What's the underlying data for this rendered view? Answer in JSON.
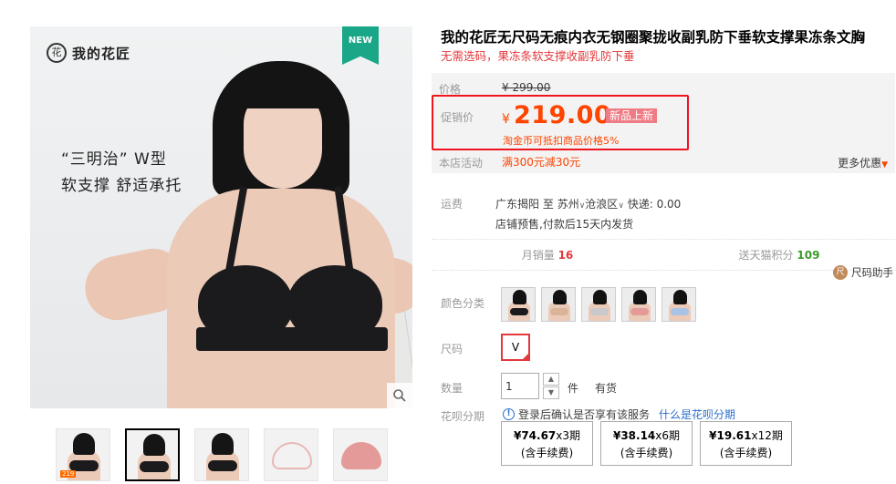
{
  "gallery": {
    "brand_logo_text": "我的花匠",
    "brand_logo_mark": "花",
    "new_badge": "NEW",
    "promo_line1": "“三明治” W型",
    "promo_line2": "软支撑  舒适承托",
    "thumbnail_price_tag": "219",
    "zoom_icon": "magnifier-icon",
    "thumbnail_count": 5,
    "active_thumbnail_index": 1
  },
  "product": {
    "title": "我的花匠无尺码无痕内衣无钢圈聚拢收副乳防下垂软支撑果冻条文胸",
    "subtitle": "无需选码，果冻条软支撑收副乳防下垂"
  },
  "pricing": {
    "original_label": "价格",
    "original_price": "¥ 299.00",
    "promo_label": "促销价",
    "currency_symbol": "¥",
    "promo_price": "219.00",
    "promo_tag": "新品上新",
    "coin_note": "淘金币可抵扣商品价格5%",
    "activity_label": "本店活动",
    "activity_value": "满300元减30元",
    "more_offers": "更多优惠",
    "more_offers_icon": "caret-down-icon"
  },
  "shipping": {
    "label": "运费",
    "origin": "广东揭阳",
    "to": "至",
    "city": "苏州",
    "district": "沧浪区",
    "express": "快递: 0.00",
    "presale_note": "店铺预售,付款后15天内发货"
  },
  "stats": {
    "monthly_sales_label": "月销量",
    "monthly_sales_value": "16",
    "tmall_points_label": "送天猫积分",
    "tmall_points_value": "109"
  },
  "size_helper": {
    "label": "尺码助手",
    "icon": "ruler-icon"
  },
  "options": {
    "color_label": "颜色分类",
    "color_swatches": [
      {
        "name": "black",
        "bra_color": "#1b1b1d"
      },
      {
        "name": "nude",
        "bra_color": "#d9b49a"
      },
      {
        "name": "grey",
        "bra_color": "#c9c9cc"
      },
      {
        "name": "pink",
        "bra_color": "#e39a98"
      },
      {
        "name": "blue",
        "bra_color": "#a9c3e6"
      }
    ],
    "size_label": "尺码",
    "size_value": "V",
    "quantity_label": "数量",
    "quantity_value": "1",
    "quantity_unit": "件",
    "stock_status": "有货"
  },
  "huabei": {
    "label": "花呗分期",
    "note": "登录后确认是否享有该服务",
    "link": "什么是花呗分期",
    "plans": [
      {
        "amount": "¥74.67",
        "term": "x3期",
        "fee": "(含手续费)"
      },
      {
        "amount": "¥38.14",
        "term": "x6期",
        "fee": "(含手续费)"
      },
      {
        "amount": "¥19.61",
        "term": "x12期",
        "fee": "(含手续费)"
      }
    ]
  },
  "colors": {
    "accent_red": "#e4393c",
    "price_orange": "#ff4400",
    "highlight_box": "#f0141e",
    "badge_green": "#1aa788",
    "link_blue": "#2a6ecb"
  }
}
